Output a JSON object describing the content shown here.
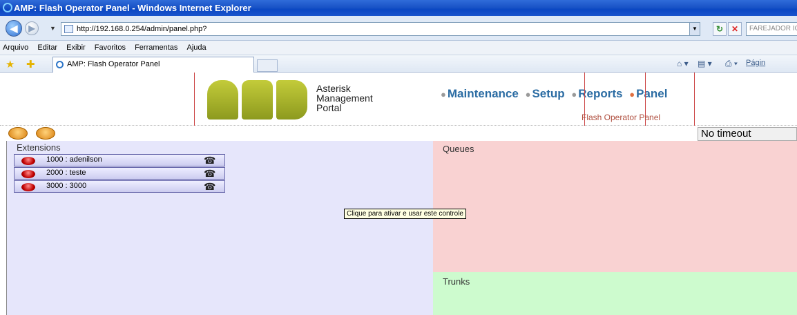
{
  "window": {
    "title": "AMP: Flash Operator Panel - Windows Internet Explorer"
  },
  "addressbar": {
    "url": "http://192.168.0.254/admin/panel.php?",
    "search_placeholder": "FAREJADOR IG"
  },
  "menubar": {
    "items": [
      "Arquivo",
      "Editar",
      "Exibir",
      "Favoritos",
      "Ferramentas",
      "Ajuda"
    ]
  },
  "tabs": [
    {
      "label": "AMP: Flash Operator Panel"
    }
  ],
  "commandbar": {
    "page_label": "Págin"
  },
  "amp": {
    "logo_text": "AMP",
    "subtitle_lines": [
      "Asterisk",
      "Management",
      "Portal"
    ],
    "nav": [
      "Maintenance",
      "Setup",
      "Reports",
      "Panel"
    ],
    "active_section": "Panel",
    "section_subtitle": "Flash Operator Panel"
  },
  "panel": {
    "timeout_text": "No timeout",
    "extensions_title": "Extensions",
    "queues_title": "Queues",
    "trunks_title": "Trunks",
    "extensions": [
      {
        "label": "1000 : adenilson"
      },
      {
        "label": "2000 : teste"
      },
      {
        "label": "3000 : 3000"
      }
    ],
    "tooltip": "Clique para ativar e usar este controle"
  }
}
